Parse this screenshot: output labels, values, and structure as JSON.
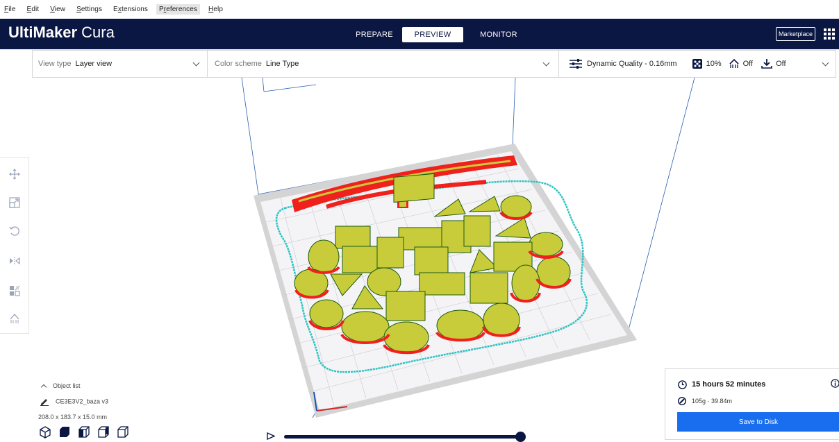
{
  "menubar": {
    "items": [
      {
        "label": "File",
        "underline": "F",
        "rest": "ile"
      },
      {
        "label": "Edit",
        "underline": "E",
        "rest": "dit"
      },
      {
        "label": "View",
        "underline": "V",
        "rest": "iew"
      },
      {
        "label": "Settings",
        "underline": "S",
        "rest": "ettings"
      },
      {
        "label": "Extensions",
        "underline": "x",
        "pre": "E",
        "rest": "tensions"
      },
      {
        "label": "Preferences",
        "underline": "r",
        "pre": "P",
        "rest": "eferences"
      },
      {
        "label": "Help",
        "underline": "H",
        "rest": "elp"
      }
    ]
  },
  "header": {
    "logo_bold": "UltiMaker",
    "logo_light": "Cura",
    "tabs": [
      "PREPARE",
      "PREVIEW",
      "MONITOR"
    ],
    "active_tab": "PREVIEW",
    "marketplace": "Marketplace",
    "bg_color": "#0b1743"
  },
  "toolbar": {
    "view_type_label": "View type",
    "view_type_value": "Layer view",
    "color_scheme_label": "Color scheme",
    "color_scheme_value": "Line Type",
    "profile": "Dynamic Quality - 0.16mm",
    "infill": "10%",
    "support": "Off",
    "adhesion": "Off"
  },
  "left_tools": [
    "move-icon",
    "scale-icon",
    "rotate-icon",
    "mirror-icon",
    "per-model-settings-icon",
    "support-blocker-icon"
  ],
  "object_list": {
    "toggle_label": "Object list",
    "object_name": "CE3E3V2_baza v3",
    "dimensions": "208.0 x 183.7 x 15.0 mm"
  },
  "print_info": {
    "time": "15 hours 52 minutes",
    "material": "105g · 39.84m",
    "save_button": "Save to Disk",
    "accent_color": "#196ef0"
  },
  "layer_slider": {
    "position_fraction": 1.0
  },
  "colors": {
    "wall": "#f0211c",
    "infill": "#c9cc3a",
    "skirt": "#2ec3c3",
    "plate": "#d4d4d4"
  }
}
